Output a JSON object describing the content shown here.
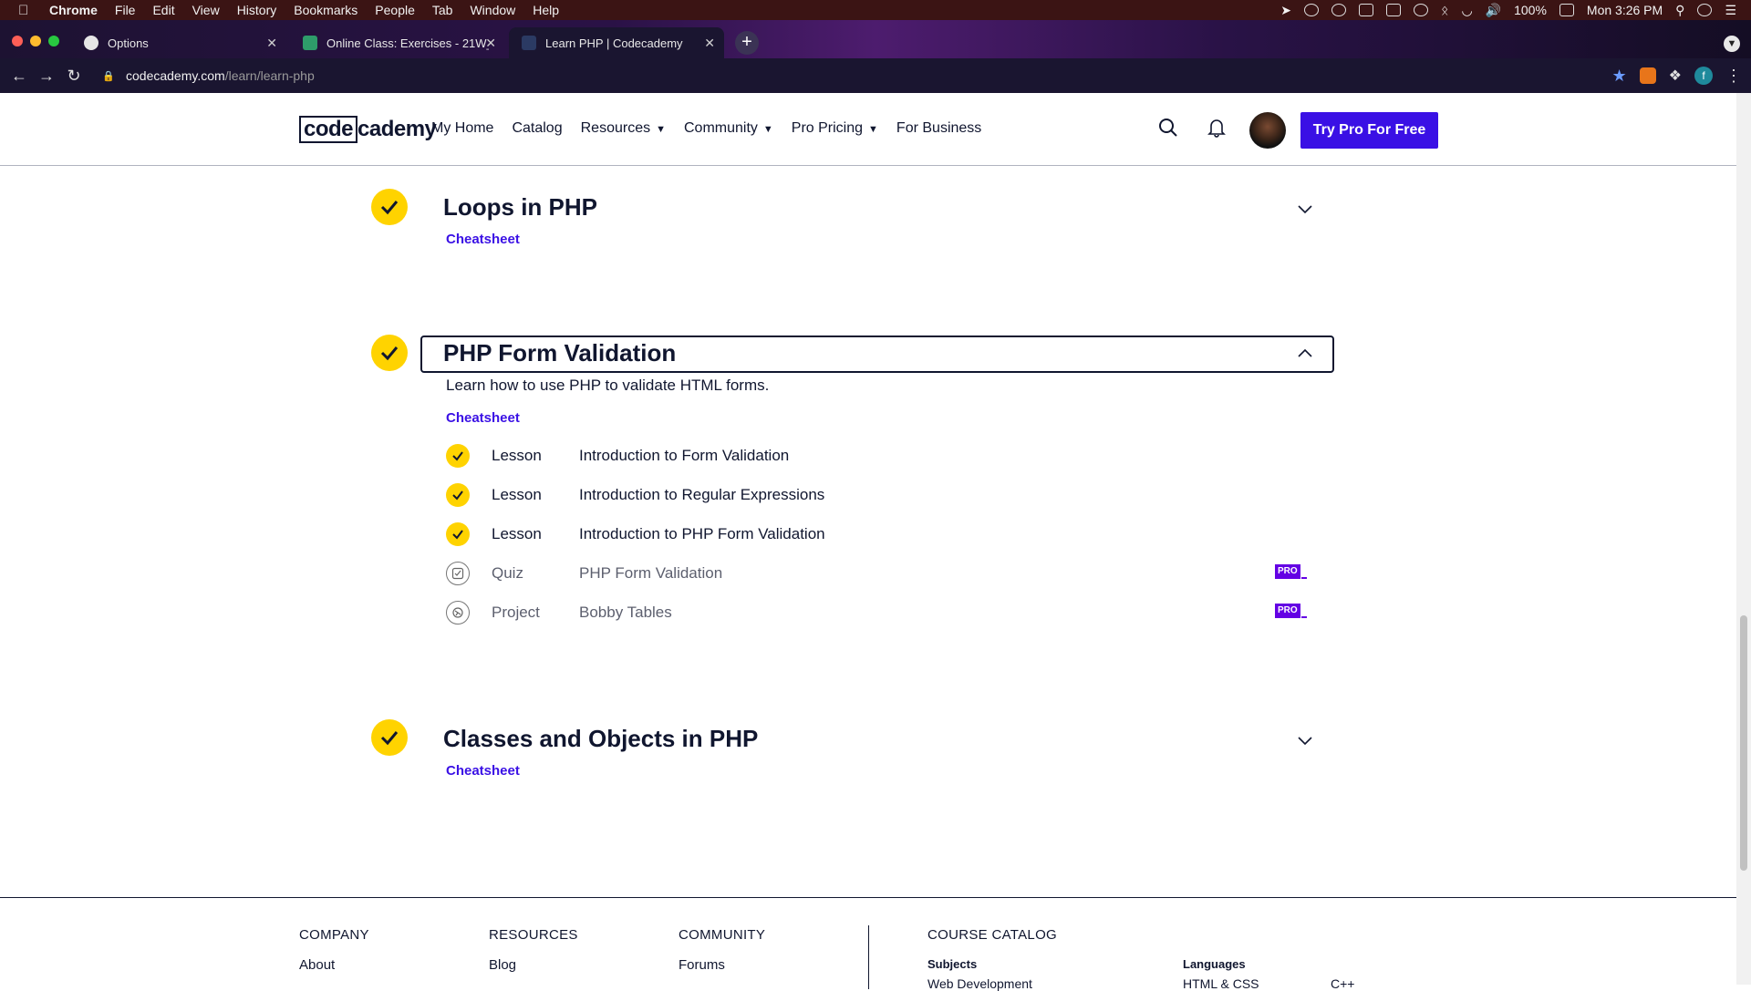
{
  "menubar": {
    "app": "Chrome",
    "items": [
      "File",
      "Edit",
      "View",
      "History",
      "Bookmarks",
      "People",
      "Tab",
      "Window",
      "Help"
    ],
    "battery": "100%",
    "clock": "Mon 3:26 PM"
  },
  "tabs": [
    {
      "title": "Options",
      "favicon": "github-icon"
    },
    {
      "title": "Online Class: Exercises - 21W_",
      "favicon": "course-icon"
    },
    {
      "title": "Learn PHP | Codecademy",
      "favicon": "codecademy-icon"
    }
  ],
  "address": {
    "host": "codecademy.com",
    "path": "/learn/learn-php"
  },
  "profile_initial": "f",
  "header": {
    "logo_a": "code",
    "logo_b": "cademy",
    "nav": {
      "my_home": "My Home",
      "catalog": "Catalog",
      "resources": "Resources",
      "community": "Community",
      "pro_pricing": "Pro Pricing",
      "for_business": "For Business"
    },
    "cta": "Try Pro For Free"
  },
  "modules": {
    "loops": {
      "title": "Loops in PHP",
      "cheatsheet": "Cheatsheet"
    },
    "form": {
      "title": "PHP Form Validation",
      "description": "Learn how to use PHP to validate HTML forms.",
      "cheatsheet": "Cheatsheet",
      "items": [
        {
          "type": "Lesson",
          "name": "Introduction to Form Validation"
        },
        {
          "type": "Lesson",
          "name": "Introduction to Regular Expressions"
        },
        {
          "type": "Lesson",
          "name": "Introduction to PHP Form Validation"
        },
        {
          "type": "Quiz",
          "name": "PHP Form Validation",
          "badge": "PRO"
        },
        {
          "type": "Project",
          "name": "Bobby Tables",
          "badge": "PRO"
        }
      ]
    },
    "classes": {
      "title": "Classes and Objects in PHP",
      "cheatsheet": "Cheatsheet"
    }
  },
  "footer": {
    "company": "COMPANY",
    "about": "About",
    "resources": "RESOURCES",
    "blog": "Blog",
    "community": "COMMUNITY",
    "forums": "Forums",
    "catalog": "COURSE CATALOG",
    "subjects": "Subjects",
    "subject_first": "Web Development",
    "languages": "Languages",
    "lang_first": "HTML & CSS",
    "lang_second": "C++"
  },
  "colors": {
    "accent": "#3a10e5",
    "check": "#ffd300",
    "pro": "#6400e4",
    "text": "#10162f"
  }
}
